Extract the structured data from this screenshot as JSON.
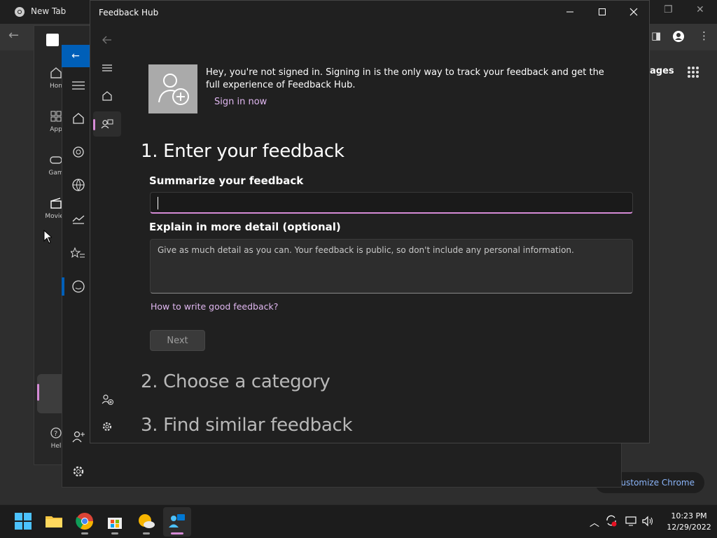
{
  "chrome": {
    "tab_title": "New Tab",
    "images_label": "ages",
    "customize_label": "ustomize Chrome"
  },
  "store": {
    "items": [
      {
        "label": "Hon",
        "icon": "home-icon"
      },
      {
        "label": "App",
        "icon": "apps-icon"
      },
      {
        "label": "Gam",
        "icon": "gamepad-icon"
      },
      {
        "label": "Movies",
        "icon": "movies-icon"
      },
      {
        "label": "Hel",
        "icon": "help-icon"
      }
    ]
  },
  "feedback_hub": {
    "window_title": "Feedback Hub",
    "signin_message": "Hey, you're not signed in. Signing in is the only way to track your feedback and get the full experience of Feedback Hub.",
    "signin_link": "Sign in now",
    "step1_heading": "1. Enter your feedback",
    "summary_label": "Summarize your feedback",
    "summary_value": "",
    "detail_label": "Explain in more detail (optional)",
    "detail_placeholder": "Give as much detail as you can. Your feedback is public, so don't include any personal information.",
    "howto_link": "How to write good feedback?",
    "next_label": "Next",
    "step2_heading": "2. Choose a category",
    "step3_heading": "3. Find similar feedback",
    "accent_color": "#d58bd6"
  },
  "taskbar": {
    "time": "10:23 PM",
    "date": "12/29/2022"
  }
}
